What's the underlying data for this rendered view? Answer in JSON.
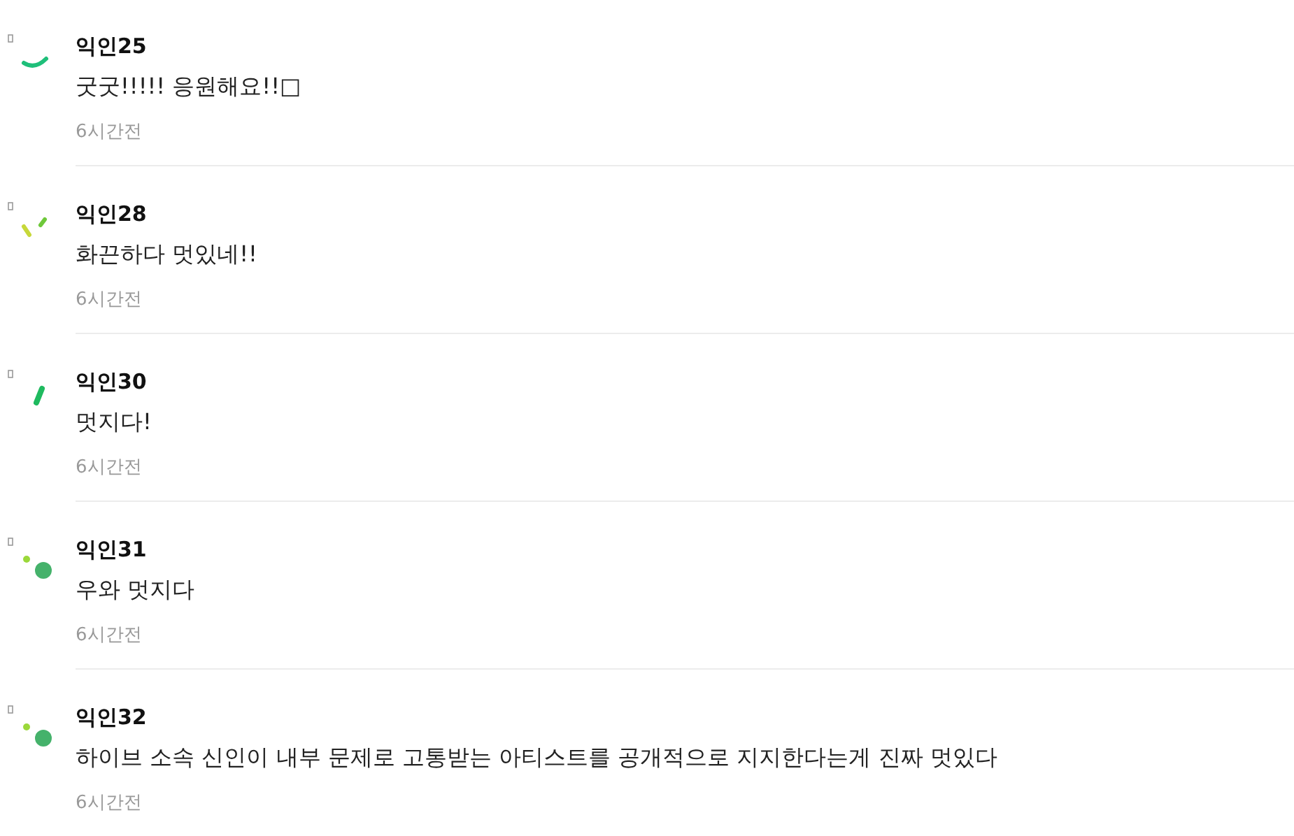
{
  "comments": [
    {
      "kind": "arc",
      "author": "익인25",
      "text": "굿굿!!!!! 응원해요!!□",
      "time": "6시간전"
    },
    {
      "kind": "dashes",
      "author": "익인28",
      "text": "화끈하다 멋있네!!",
      "time": "6시간전"
    },
    {
      "kind": "slash",
      "author": "익인30",
      "text": "멋지다!",
      "time": "6시간전"
    },
    {
      "kind": "dots",
      "author": "익인31",
      "text": "우와 멋지다",
      "time": "6시간전"
    },
    {
      "kind": "dots",
      "author": "익인32",
      "text": "하이브 소속 신인이 내부 문제로 고통받는 아티스트를 공개적으로 지지한다는게 진짜 멋있다",
      "time": "6시간전"
    }
  ]
}
